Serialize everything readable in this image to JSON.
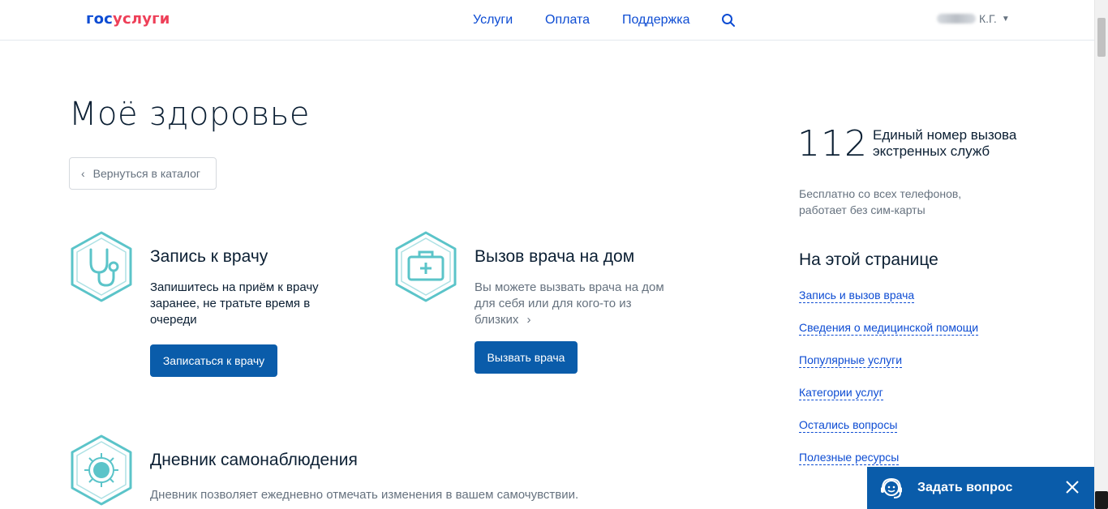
{
  "header": {
    "logo_part1": "гос",
    "logo_part2": "услуги",
    "nav": [
      "Услуги",
      "Оплата",
      "Поддержка"
    ],
    "user_name": "К.Г."
  },
  "main": {
    "title": "Моё здоровье",
    "back_label": "Вернуться в каталог",
    "cards": [
      {
        "title": "Запись к врачу",
        "desc": "Запишитесь на приём к врачу заранее, не тратьте время в очереди",
        "button": "Записаться к врачу",
        "icon": "stethoscope-icon"
      },
      {
        "title": "Вызов врача на дом",
        "desc": "Вы можете вызвать врача на дом для себя или для кого-то из близких",
        "button": "Вызвать врача",
        "icon": "medical-kit-icon"
      },
      {
        "title": "Дневник самонаблюдения",
        "desc": "Дневник позволяет ежедневно отмечать изменения в вашем самочувствии.",
        "icon": "virus-icon"
      }
    ]
  },
  "sidebar": {
    "emergency_number": "112",
    "emergency_label": "Единый номер вызова экстренных служб",
    "emergency_note": "Бесплатно со всех телефонов, работает без сим-карты",
    "toc_title": "На этой странице",
    "toc_links": [
      "Запись и вызов врача",
      "Сведения о медицинской помощи",
      "Популярные услуги",
      "Категории услуг",
      "Остались вопросы",
      "Полезные ресурсы"
    ]
  },
  "ask_widget": {
    "label": "Задать вопрос"
  },
  "colors": {
    "brand_blue": "#0d4cd3",
    "brand_red": "#ee3f58",
    "button_blue": "#0a5caa",
    "icon_teal": "#5bc4c9"
  }
}
